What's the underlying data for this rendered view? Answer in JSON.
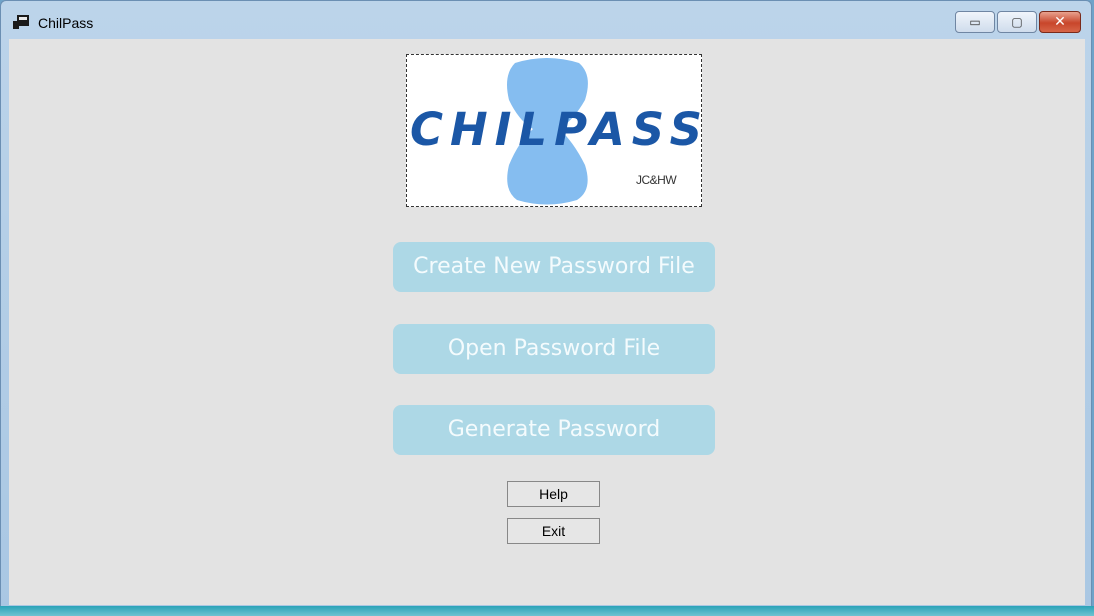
{
  "window": {
    "title": "ChilPass",
    "controls": {
      "minimize": "▭",
      "maximize": "▢",
      "close": "✕"
    }
  },
  "logo": {
    "word": "CHILPASS",
    "sub": "JC&HW"
  },
  "buttons": {
    "create": "Create New Password File",
    "open": "Open Password File",
    "generate": "Generate Password",
    "help": "Help",
    "exit": "Exit"
  },
  "colors": {
    "big_button": "#add8e6",
    "logo_text": "#1b57a6",
    "hourglass": "#85bdf0",
    "client_bg": "#e3e3e3"
  }
}
